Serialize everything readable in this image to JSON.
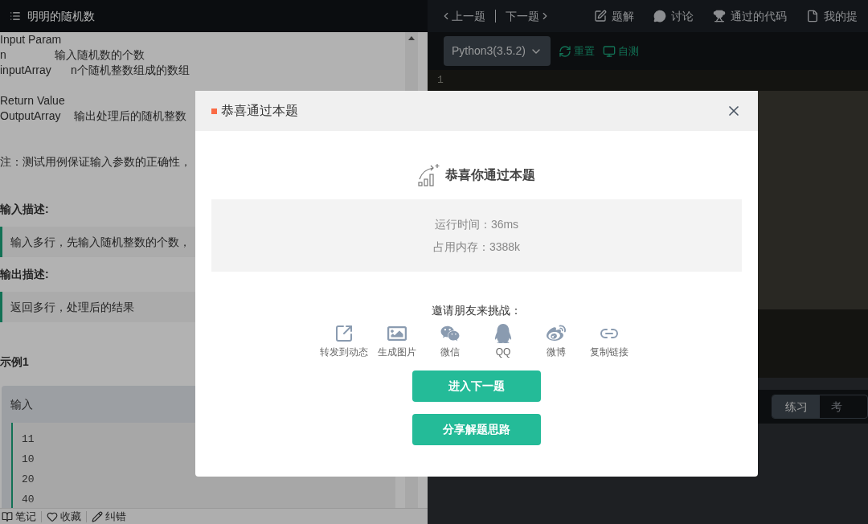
{
  "problem_header": {
    "title": "明明的随机数"
  },
  "description": {
    "input_heading": "Input Param",
    "input_params": [
      {
        "name": "n",
        "text": "输入随机数的个数"
      },
      {
        "name": "inputArray",
        "text": "n个随机整数组成的数组"
      }
    ],
    "return_heading": "Return Value",
    "return_params": [
      {
        "name": "OutputArray",
        "text": "输出处理后的随机整数"
      }
    ],
    "note": "注：测试用例保证输入参数的正确性，"
  },
  "sections": [
    {
      "heading": "输入描述:",
      "text": "输入多行，先输入随机整数的个数，"
    },
    {
      "heading": "输出描述:",
      "text": "返回多行，处理后的结果"
    }
  ],
  "example": {
    "title": "示例1",
    "label": "输入",
    "lines": [
      "11",
      "10",
      "20",
      "40"
    ]
  },
  "footer_actions": [
    {
      "kind": "note",
      "label": "笔记"
    },
    {
      "kind": "favorite",
      "label": "收藏"
    },
    {
      "kind": "report",
      "label": "纠错"
    }
  ],
  "nav": {
    "prev": "上一题",
    "next": "下一题",
    "links": [
      {
        "kind": "edit",
        "label": "题解"
      },
      {
        "kind": "chat",
        "label": "讨论"
      },
      {
        "kind": "trophy",
        "label": "通过的代码"
      },
      {
        "kind": "file",
        "label": "我的提"
      }
    ]
  },
  "toolbar": {
    "language": "Python3(3.5.2)",
    "actions": [
      {
        "kind": "reset",
        "label": "重置"
      },
      {
        "kind": "test",
        "label": "自测"
      }
    ]
  },
  "editor": {
    "line_numbers": [
      "1"
    ]
  },
  "console_tabs": [
    {
      "label": "练习",
      "selected": true
    },
    {
      "label": "考",
      "selected": false
    }
  ],
  "dialog": {
    "title": "恭喜通过本题",
    "headline": "恭喜你通过本题",
    "stats": [
      "运行时间：36ms",
      "占用内存：3388k"
    ],
    "invite_label": "邀请朋友来挑战：",
    "share": [
      {
        "kind": "repost",
        "label": "转发到动态"
      },
      {
        "kind": "image",
        "label": "生成图片"
      },
      {
        "kind": "wechat",
        "label": "微信"
      },
      {
        "kind": "qq",
        "label": "QQ"
      },
      {
        "kind": "weibo",
        "label": "微博"
      },
      {
        "kind": "link",
        "label": "复制链接"
      }
    ],
    "buttons": [
      "进入下一题",
      "分享解题思路"
    ]
  }
}
